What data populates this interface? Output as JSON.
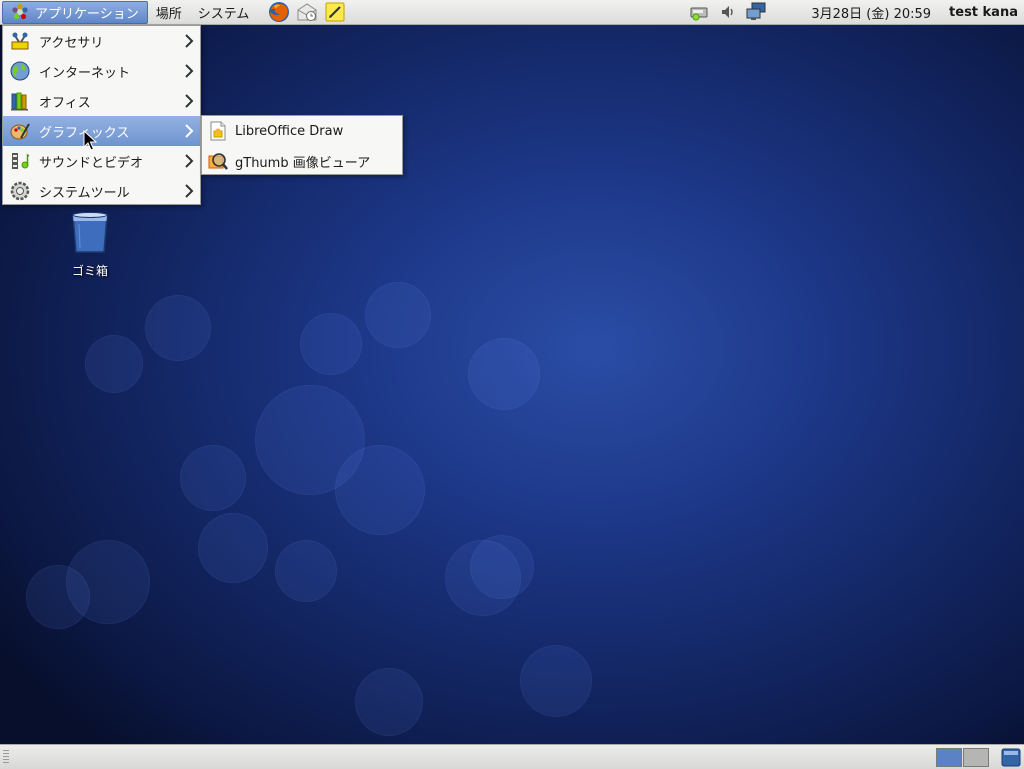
{
  "top_panel": {
    "applications_label": "アプリケーション",
    "places_label": "場所",
    "system_label": "システム",
    "launchers": [
      "firefox-icon",
      "mail-icon",
      "notes-icon"
    ],
    "tray_icons": [
      "network-icon",
      "volume-icon",
      "display-icon"
    ],
    "clock": "3月28日 (金) 20:59",
    "user": "test kana"
  },
  "app_menu": {
    "items": [
      {
        "label": "アクセサリ",
        "icon": "accessories-icon"
      },
      {
        "label": "インターネット",
        "icon": "internet-icon"
      },
      {
        "label": "オフィス",
        "icon": "office-icon"
      },
      {
        "label": "グラフィックス",
        "icon": "graphics-icon"
      },
      {
        "label": "サウンドとビデオ",
        "icon": "sound-video-icon"
      },
      {
        "label": "システムツール",
        "icon": "system-tools-icon"
      }
    ],
    "active_index": 3
  },
  "graphics_submenu": {
    "items": [
      {
        "label": "LibreOffice Draw",
        "icon": "libreoffice-draw-icon"
      },
      {
        "label": "gThumb 画像ビューア",
        "icon": "gthumb-icon"
      }
    ]
  },
  "desktop": {
    "trash_label": "ゴミ箱"
  },
  "colors": {
    "menu_highlight": "#6e93cf",
    "desktop_base": "#132663"
  }
}
